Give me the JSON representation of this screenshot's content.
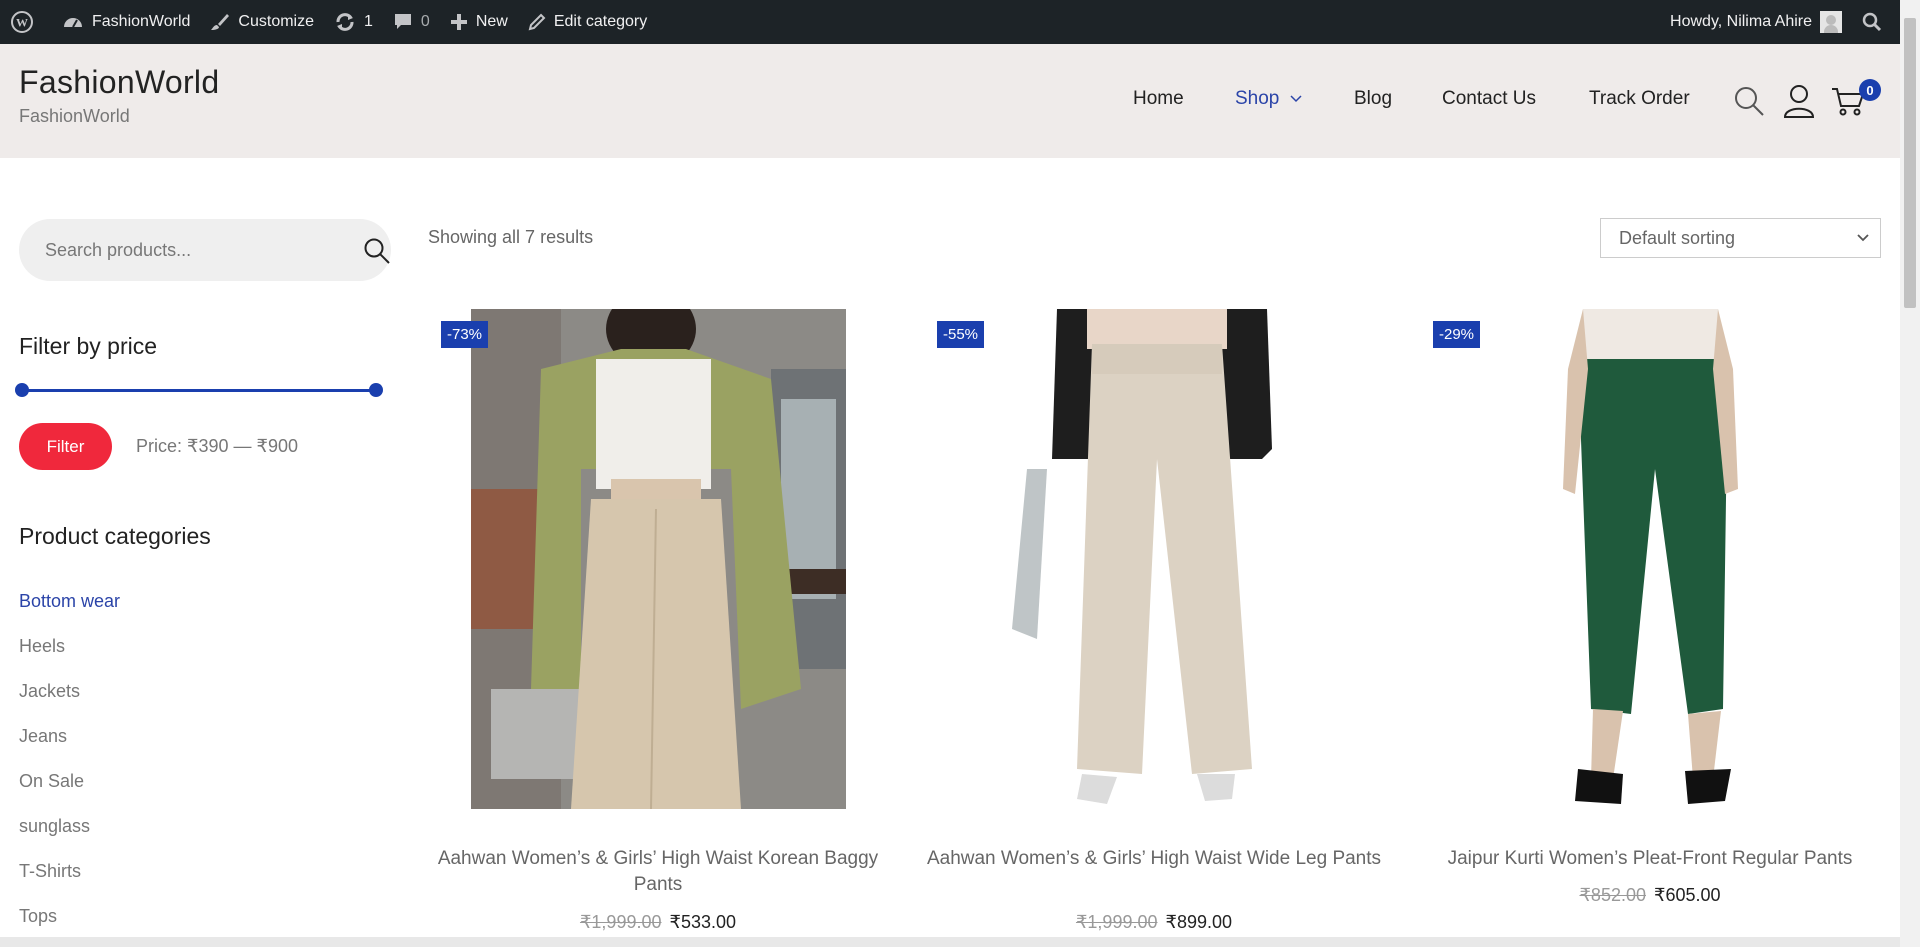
{
  "adminbar": {
    "site_name": "FashionWorld",
    "customize": "Customize",
    "updates_count": "1",
    "comments_count": "0",
    "new_label": "New",
    "edit_label": "Edit category",
    "howdy": "Howdy, Nilima Ahire"
  },
  "header": {
    "site_title": "FashionWorld",
    "tagline": "FashionWorld",
    "nav": [
      "Home",
      "Shop",
      "Blog",
      "Contact Us",
      "Track Order"
    ],
    "cart_count": "0",
    "accent_color": "#1a3fae"
  },
  "sidebar": {
    "search_placeholder": "Search products...",
    "filter_title": "Filter by price",
    "filter_button": "Filter",
    "price_label": "Price: ₹390 — ₹900",
    "categories_title": "Product categories",
    "categories": [
      "Bottom wear",
      "Heels",
      "Jackets",
      "Jeans",
      "On Sale",
      "sunglass",
      "T-Shirts",
      "Tops"
    ]
  },
  "shop": {
    "result_count": "Showing all 7 results",
    "sorting": "Default sorting",
    "products": [
      {
        "badge": "-73%",
        "title": "Aahwan Women’s & Girls’ High Waist Korean Baggy Pants",
        "old_price": "₹1,999.00",
        "price": "₹533.00"
      },
      {
        "badge": "-55%",
        "title": "Aahwan Women’s & Girls’ High Waist Wide Leg Pants",
        "old_price": "₹1,999.00",
        "price": "₹899.00"
      },
      {
        "badge": "-29%",
        "title": "Jaipur Kurti Women’s Pleat-Front Regular Pants",
        "old_price": "₹852.00",
        "price": "₹605.00"
      }
    ]
  }
}
